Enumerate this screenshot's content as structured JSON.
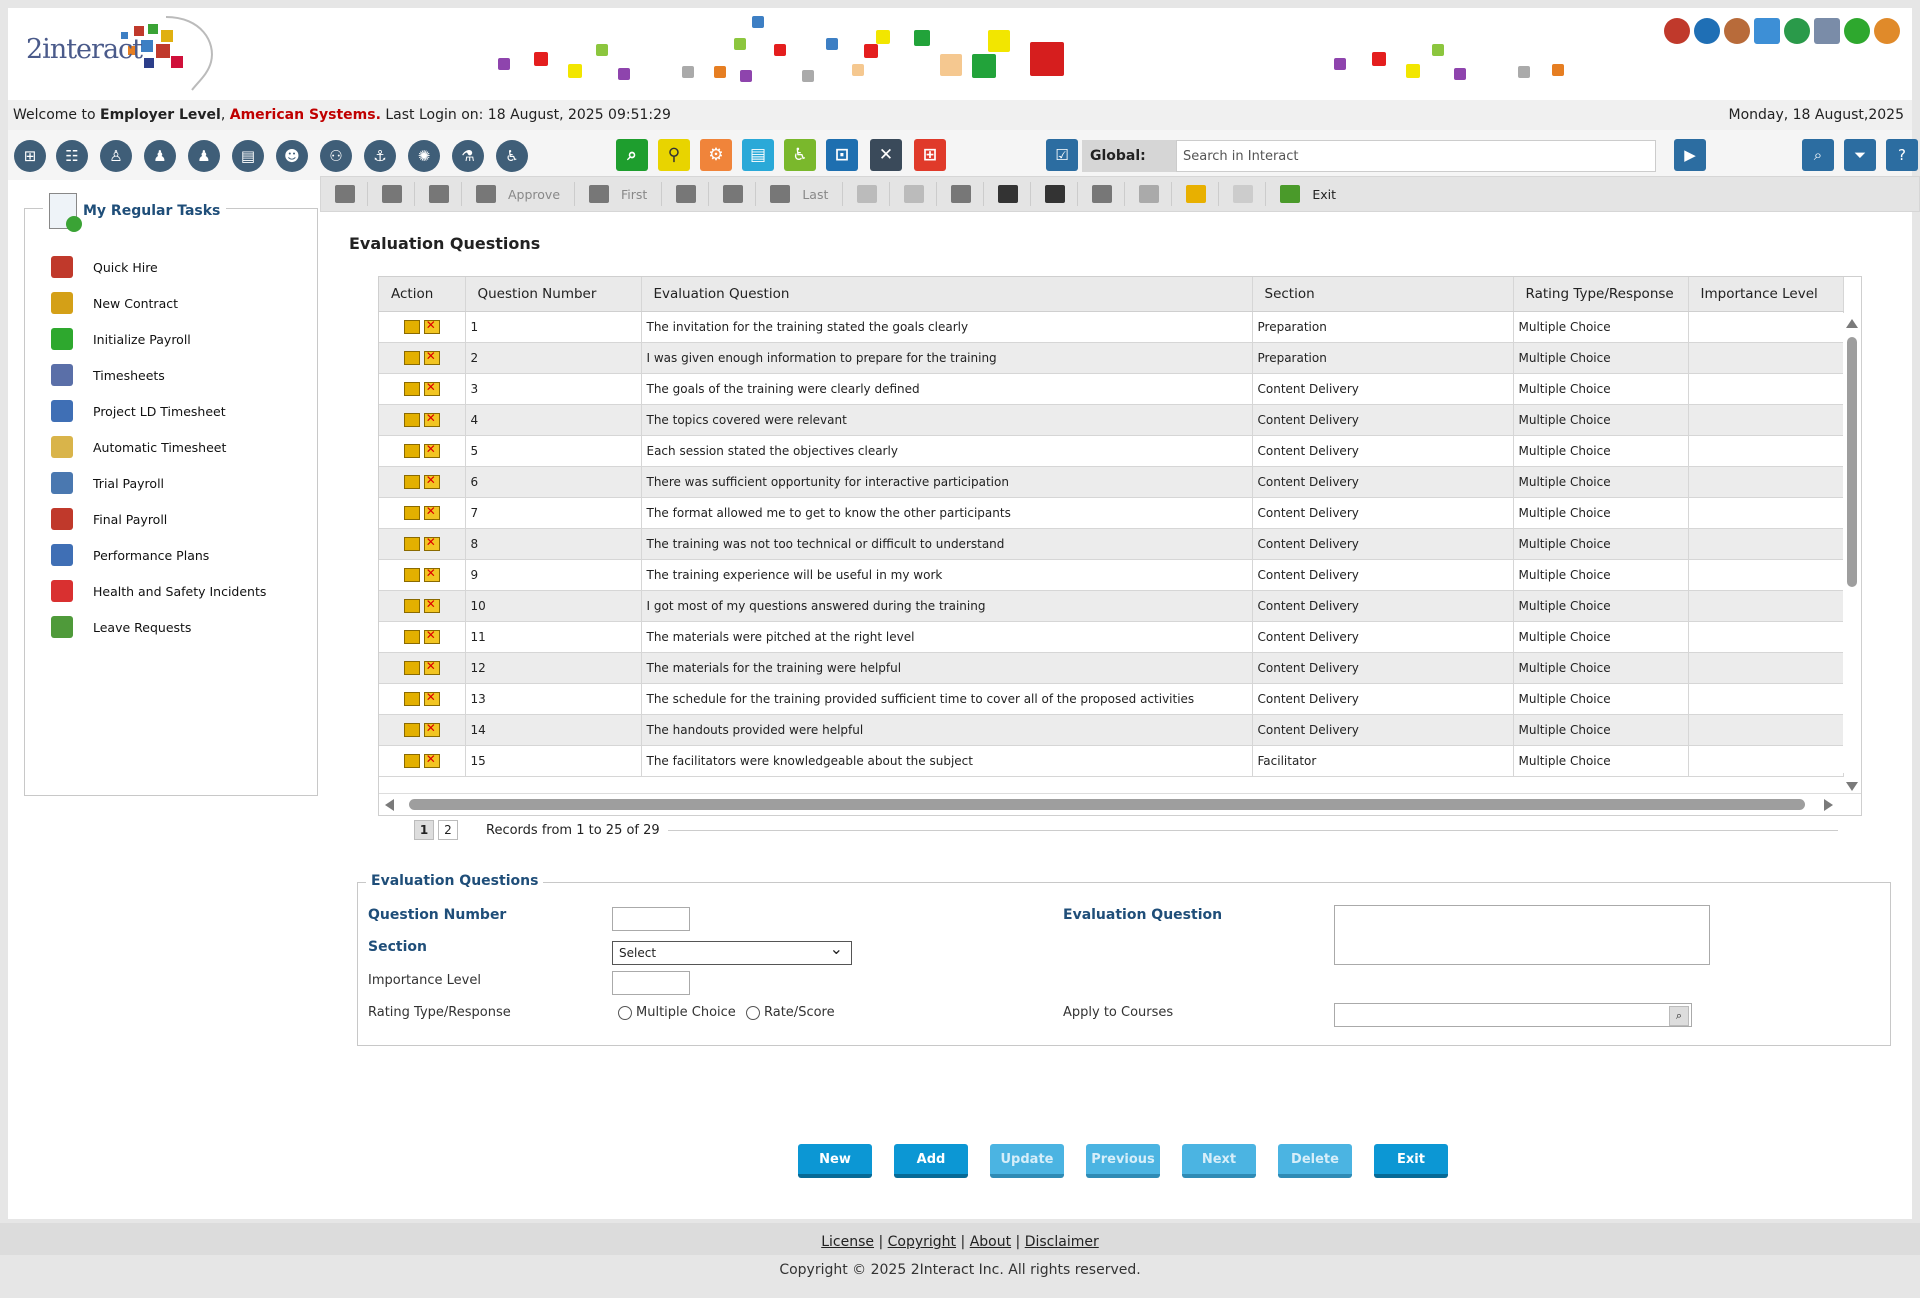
{
  "brand": {
    "logo_text": "2interact"
  },
  "welcome": {
    "prefix": "Welcome to ",
    "level": "Employer Level",
    "sep": ", ",
    "company": "American Systems.",
    "last_login": " Last Login on: 18 August, 2025 09:51:29",
    "date": "Monday, 18 August,2025"
  },
  "toolbar": {
    "global_label": "Global:",
    "search_placeholder": "Search in Interact"
  },
  "tasks": {
    "title": "My Regular Tasks",
    "items": [
      {
        "label": "Quick Hire",
        "icon": "quick-hire-icon",
        "color": "#c0392b"
      },
      {
        "label": "New Contract",
        "icon": "contract-icon",
        "color": "#d4a017"
      },
      {
        "label": "Initialize Payroll",
        "icon": "green-dot-icon",
        "color": "#2ea82e"
      },
      {
        "label": "Timesheets",
        "icon": "timesheet-icon",
        "color": "#5a6fa8"
      },
      {
        "label": "Project LD Timesheet",
        "icon": "checklist-icon",
        "color": "#3f6fb5"
      },
      {
        "label": "Automatic Timesheet",
        "icon": "clock-icon",
        "color": "#d9b44a"
      },
      {
        "label": "Trial Payroll",
        "icon": "calendar-icon",
        "color": "#4a78b0"
      },
      {
        "label": "Final Payroll",
        "icon": "payroll-icon",
        "color": "#c0392b"
      },
      {
        "label": "Performance Plans",
        "icon": "checklist-icon",
        "color": "#3f6fb5"
      },
      {
        "label": "Health and Safety Incidents",
        "icon": "first-aid-icon",
        "color": "#d93030"
      },
      {
        "label": "Leave Requests",
        "icon": "landscape-icon",
        "color": "#4f9a3a"
      }
    ]
  },
  "cmdbar": {
    "approve": "Approve",
    "first": "First",
    "last": "Last",
    "exit": "Exit"
  },
  "page": {
    "title": "Evaluation Questions"
  },
  "grid": {
    "columns": [
      "Action",
      "Question Number",
      "Evaluation Question",
      "Section",
      "Rating Type/Response",
      "Importance Level"
    ],
    "rows": [
      {
        "num": "1",
        "question": "The invitation for the training stated the goals clearly",
        "section": "Preparation",
        "rating": "Multiple Choice",
        "importance": ""
      },
      {
        "num": "2",
        "question": "I was given enough information to prepare for the training",
        "section": "Preparation",
        "rating": "Multiple Choice",
        "importance": ""
      },
      {
        "num": "3",
        "question": "The goals of the training were clearly defined",
        "section": "Content Delivery",
        "rating": "Multiple Choice",
        "importance": ""
      },
      {
        "num": "4",
        "question": "The topics covered were relevant",
        "section": "Content Delivery",
        "rating": "Multiple Choice",
        "importance": ""
      },
      {
        "num": "5",
        "question": "Each session stated the objectives clearly",
        "section": "Content Delivery",
        "rating": "Multiple Choice",
        "importance": ""
      },
      {
        "num": "6",
        "question": "There was sufficient opportunity for interactive participation",
        "section": "Content Delivery",
        "rating": "Multiple Choice",
        "importance": ""
      },
      {
        "num": "7",
        "question": "The format allowed me to get to know the other participants",
        "section": "Content Delivery",
        "rating": "Multiple Choice",
        "importance": ""
      },
      {
        "num": "8",
        "question": "The training was not too technical or difficult to understand",
        "section": "Content Delivery",
        "rating": "Multiple Choice",
        "importance": ""
      },
      {
        "num": "9",
        "question": "The training experience will be useful in my work",
        "section": "Content Delivery",
        "rating": "Multiple Choice",
        "importance": ""
      },
      {
        "num": "10",
        "question": "I got most of my questions answered during the training",
        "section": "Content Delivery",
        "rating": "Multiple Choice",
        "importance": ""
      },
      {
        "num": "11",
        "question": "The materials were pitched at the right level",
        "section": "Content Delivery",
        "rating": "Multiple Choice",
        "importance": ""
      },
      {
        "num": "12",
        "question": "The materials for the training were helpful",
        "section": "Content Delivery",
        "rating": "Multiple Choice",
        "importance": ""
      },
      {
        "num": "13",
        "question": "The schedule for the training provided sufficient time to cover all of the proposed activities",
        "section": "Content Delivery",
        "rating": "Multiple Choice",
        "importance": ""
      },
      {
        "num": "14",
        "question": "The handouts provided were helpful",
        "section": "Content Delivery",
        "rating": "Multiple Choice",
        "importance": ""
      },
      {
        "num": "15",
        "question": "The facilitators were knowledgeable about the subject",
        "section": "Facilitator",
        "rating": "Multiple Choice",
        "importance": ""
      }
    ]
  },
  "pager": {
    "pages": [
      "1",
      "2"
    ],
    "current": "1",
    "records": "Records from 1 to 25 of 29"
  },
  "form": {
    "legend": "Evaluation Questions",
    "question_number_label": "Question Number",
    "section_label": "Section",
    "section_value": "Select",
    "importance_label": "Importance Level",
    "rating_label": "Rating Type/Response",
    "rating_options": [
      "Multiple Choice",
      "Rate/Score"
    ],
    "question_label": "Evaluation Question",
    "apply_label": "Apply to Courses"
  },
  "buttons": {
    "new": "New",
    "add": "Add",
    "update": "Update",
    "previous": "Previous",
    "next": "Next",
    "delete": "Delete",
    "exit": "Exit"
  },
  "footer": {
    "links": [
      "License",
      "Copyright",
      "About",
      "Disclaimer"
    ],
    "copyright": "Copyright © 2025 2Interact Inc. All rights reserved."
  }
}
